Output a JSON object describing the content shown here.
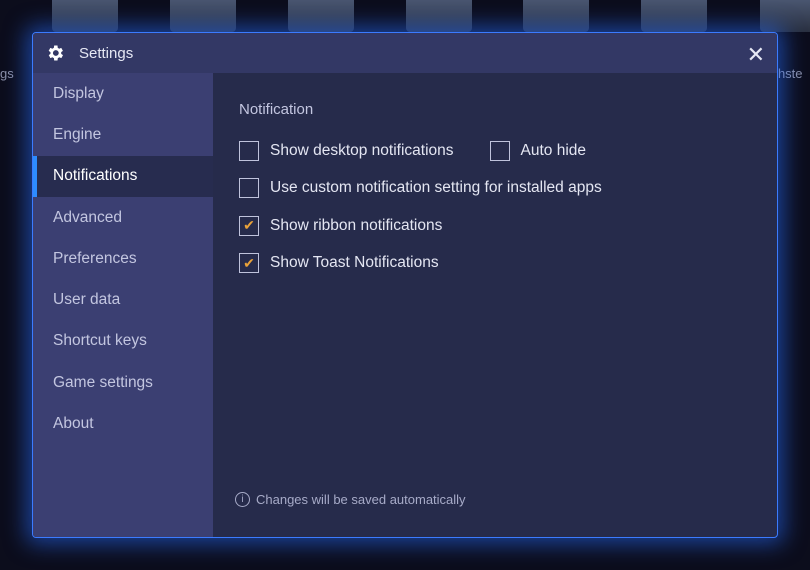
{
  "background": {
    "left_label": "gs",
    "right_label": "rthste"
  },
  "dialog": {
    "title": "Settings",
    "close_glyph": "✕"
  },
  "sidebar": {
    "items": [
      {
        "label": "Display"
      },
      {
        "label": "Engine"
      },
      {
        "label": "Notifications",
        "active": true
      },
      {
        "label": "Advanced"
      },
      {
        "label": "Preferences"
      },
      {
        "label": "User data"
      },
      {
        "label": "Shortcut keys"
      },
      {
        "label": "Game settings"
      },
      {
        "label": "About"
      }
    ]
  },
  "content": {
    "heading": "Notification",
    "options": {
      "desktop": {
        "label": "Show desktop notifications",
        "checked": false
      },
      "autohide": {
        "label": "Auto hide",
        "checked": false
      },
      "custom": {
        "label": "Use custom notification setting for installed apps",
        "checked": false
      },
      "ribbon": {
        "label": "Show ribbon notifications",
        "checked": true
      },
      "toast": {
        "label": "Show Toast Notifications",
        "checked": true
      }
    },
    "footer": "Changes will be saved automatically"
  },
  "colors": {
    "accent": "#2d8cff",
    "check": "#e8a23a",
    "border_glow": "#3b7bff"
  }
}
